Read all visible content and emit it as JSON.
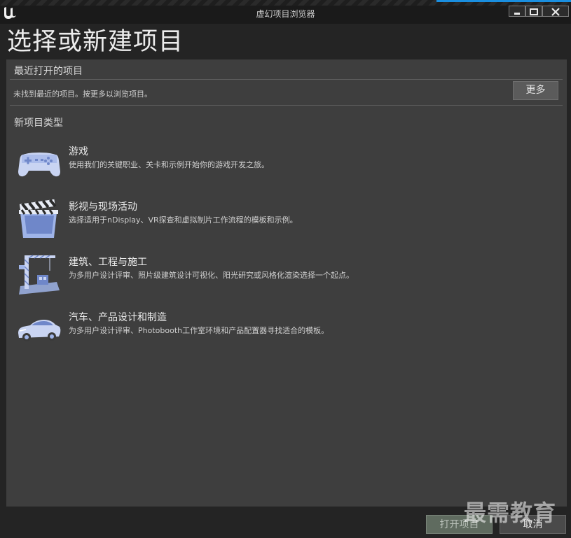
{
  "window": {
    "title": "虚幻项目浏览器"
  },
  "page": {
    "title": "选择或新建项目"
  },
  "recent": {
    "title": "最近打开的项目",
    "empty_text": "未找到最近的项目。按更多以浏览项目。",
    "more_label": "更多"
  },
  "new_types": {
    "title": "新项目类型",
    "items": [
      {
        "name": "游戏",
        "desc": "使用我们的关键职业、关卡和示例开始你的游戏开发之旅。",
        "icon": "gamepad-icon"
      },
      {
        "name": "影视与现场活动",
        "desc": "选择适用于nDisplay、VR探查和虚拟制片工作流程的模板和示例。",
        "icon": "clapperboard-icon"
      },
      {
        "name": "建筑、工程与施工",
        "desc": "为多用户设计评审、照片级建筑设计可视化、阳光研究或风格化渲染选择一个起点。",
        "icon": "crane-icon"
      },
      {
        "name": "汽车、产品设计和制造",
        "desc": "为多用户设计评审、Photobooth工作室环境和产品配置器寻找适合的模板。",
        "icon": "car-icon"
      }
    ]
  },
  "footer": {
    "open_label": "打开项目",
    "cancel_label": "取消"
  },
  "watermark": {
    "text": "最需教育"
  },
  "colors": {
    "background": "#242424",
    "panel": "#3e3e3e",
    "accent": "#1a8fe0",
    "icon_blue": "#9fb4e8"
  }
}
